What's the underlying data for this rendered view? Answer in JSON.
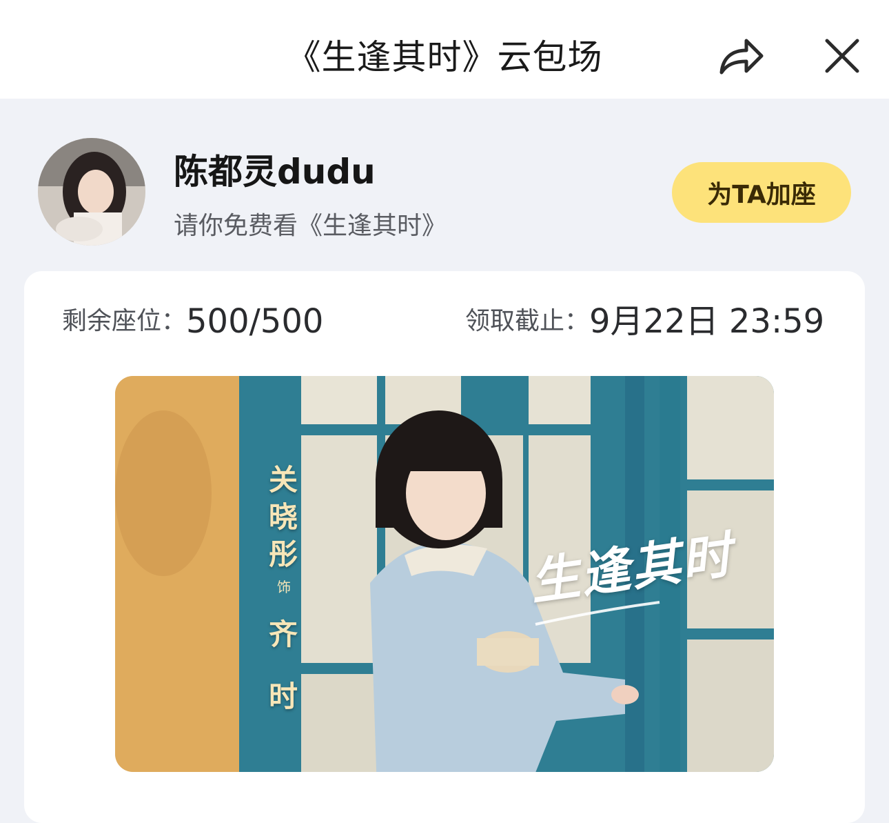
{
  "header": {
    "title": "《生逢其时》云包场",
    "share_icon": "share-arrow-icon",
    "close_icon": "close-icon"
  },
  "host": {
    "name": "陈都灵dudu",
    "subtitle": "请你免费看《生逢其时》",
    "add_seat_label": "为TA加座"
  },
  "event": {
    "seats_label": "剩余座位：",
    "seats_value": "500/500",
    "deadline_label": "领取截止：",
    "deadline_value": "9月22日 23:59"
  },
  "poster": {
    "actor": "关晓彤",
    "role_prefix": "饰",
    "role": "齐时",
    "title": "生逢其时"
  },
  "colors": {
    "accent_button": "#fde27a",
    "page_bg": "#f0f2f7"
  }
}
